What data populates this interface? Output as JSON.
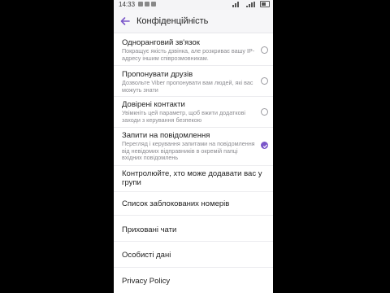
{
  "statusbar": {
    "time": "14:33"
  },
  "appbar": {
    "title": "Конфіденційність"
  },
  "toggles": [
    {
      "title": "Одноранговий зв'язок",
      "subtitle": "Покращує якість дзвінка, але розкриває вашу IP-адресу іншим співрозмовникам.",
      "checked": false
    },
    {
      "title": "Пропонувати друзів",
      "subtitle": "Дозвольте Viber пропонувати вам людей, які вас можуть знати",
      "checked": false
    },
    {
      "title": "Довірені контакти",
      "subtitle": "Увімкніть цей параметр, щоб вжити додаткові заходи з керування безпекою",
      "checked": false
    },
    {
      "title": "Запити на повідомлення",
      "subtitle": "Перегляд і керування запитами на повідомлення від невідомих відправників в окремій папці вхідних повідомлень",
      "checked": true
    }
  ],
  "items": [
    {
      "label": "Контролюйте, хто може додавати вас у групи"
    },
    {
      "label": "Список заблокованих номерів"
    },
    {
      "label": "Приховані чати"
    },
    {
      "label": "Особисті дані"
    },
    {
      "label": "Privacy Policy"
    }
  ],
  "colors": {
    "accent": "#7a56c9"
  }
}
